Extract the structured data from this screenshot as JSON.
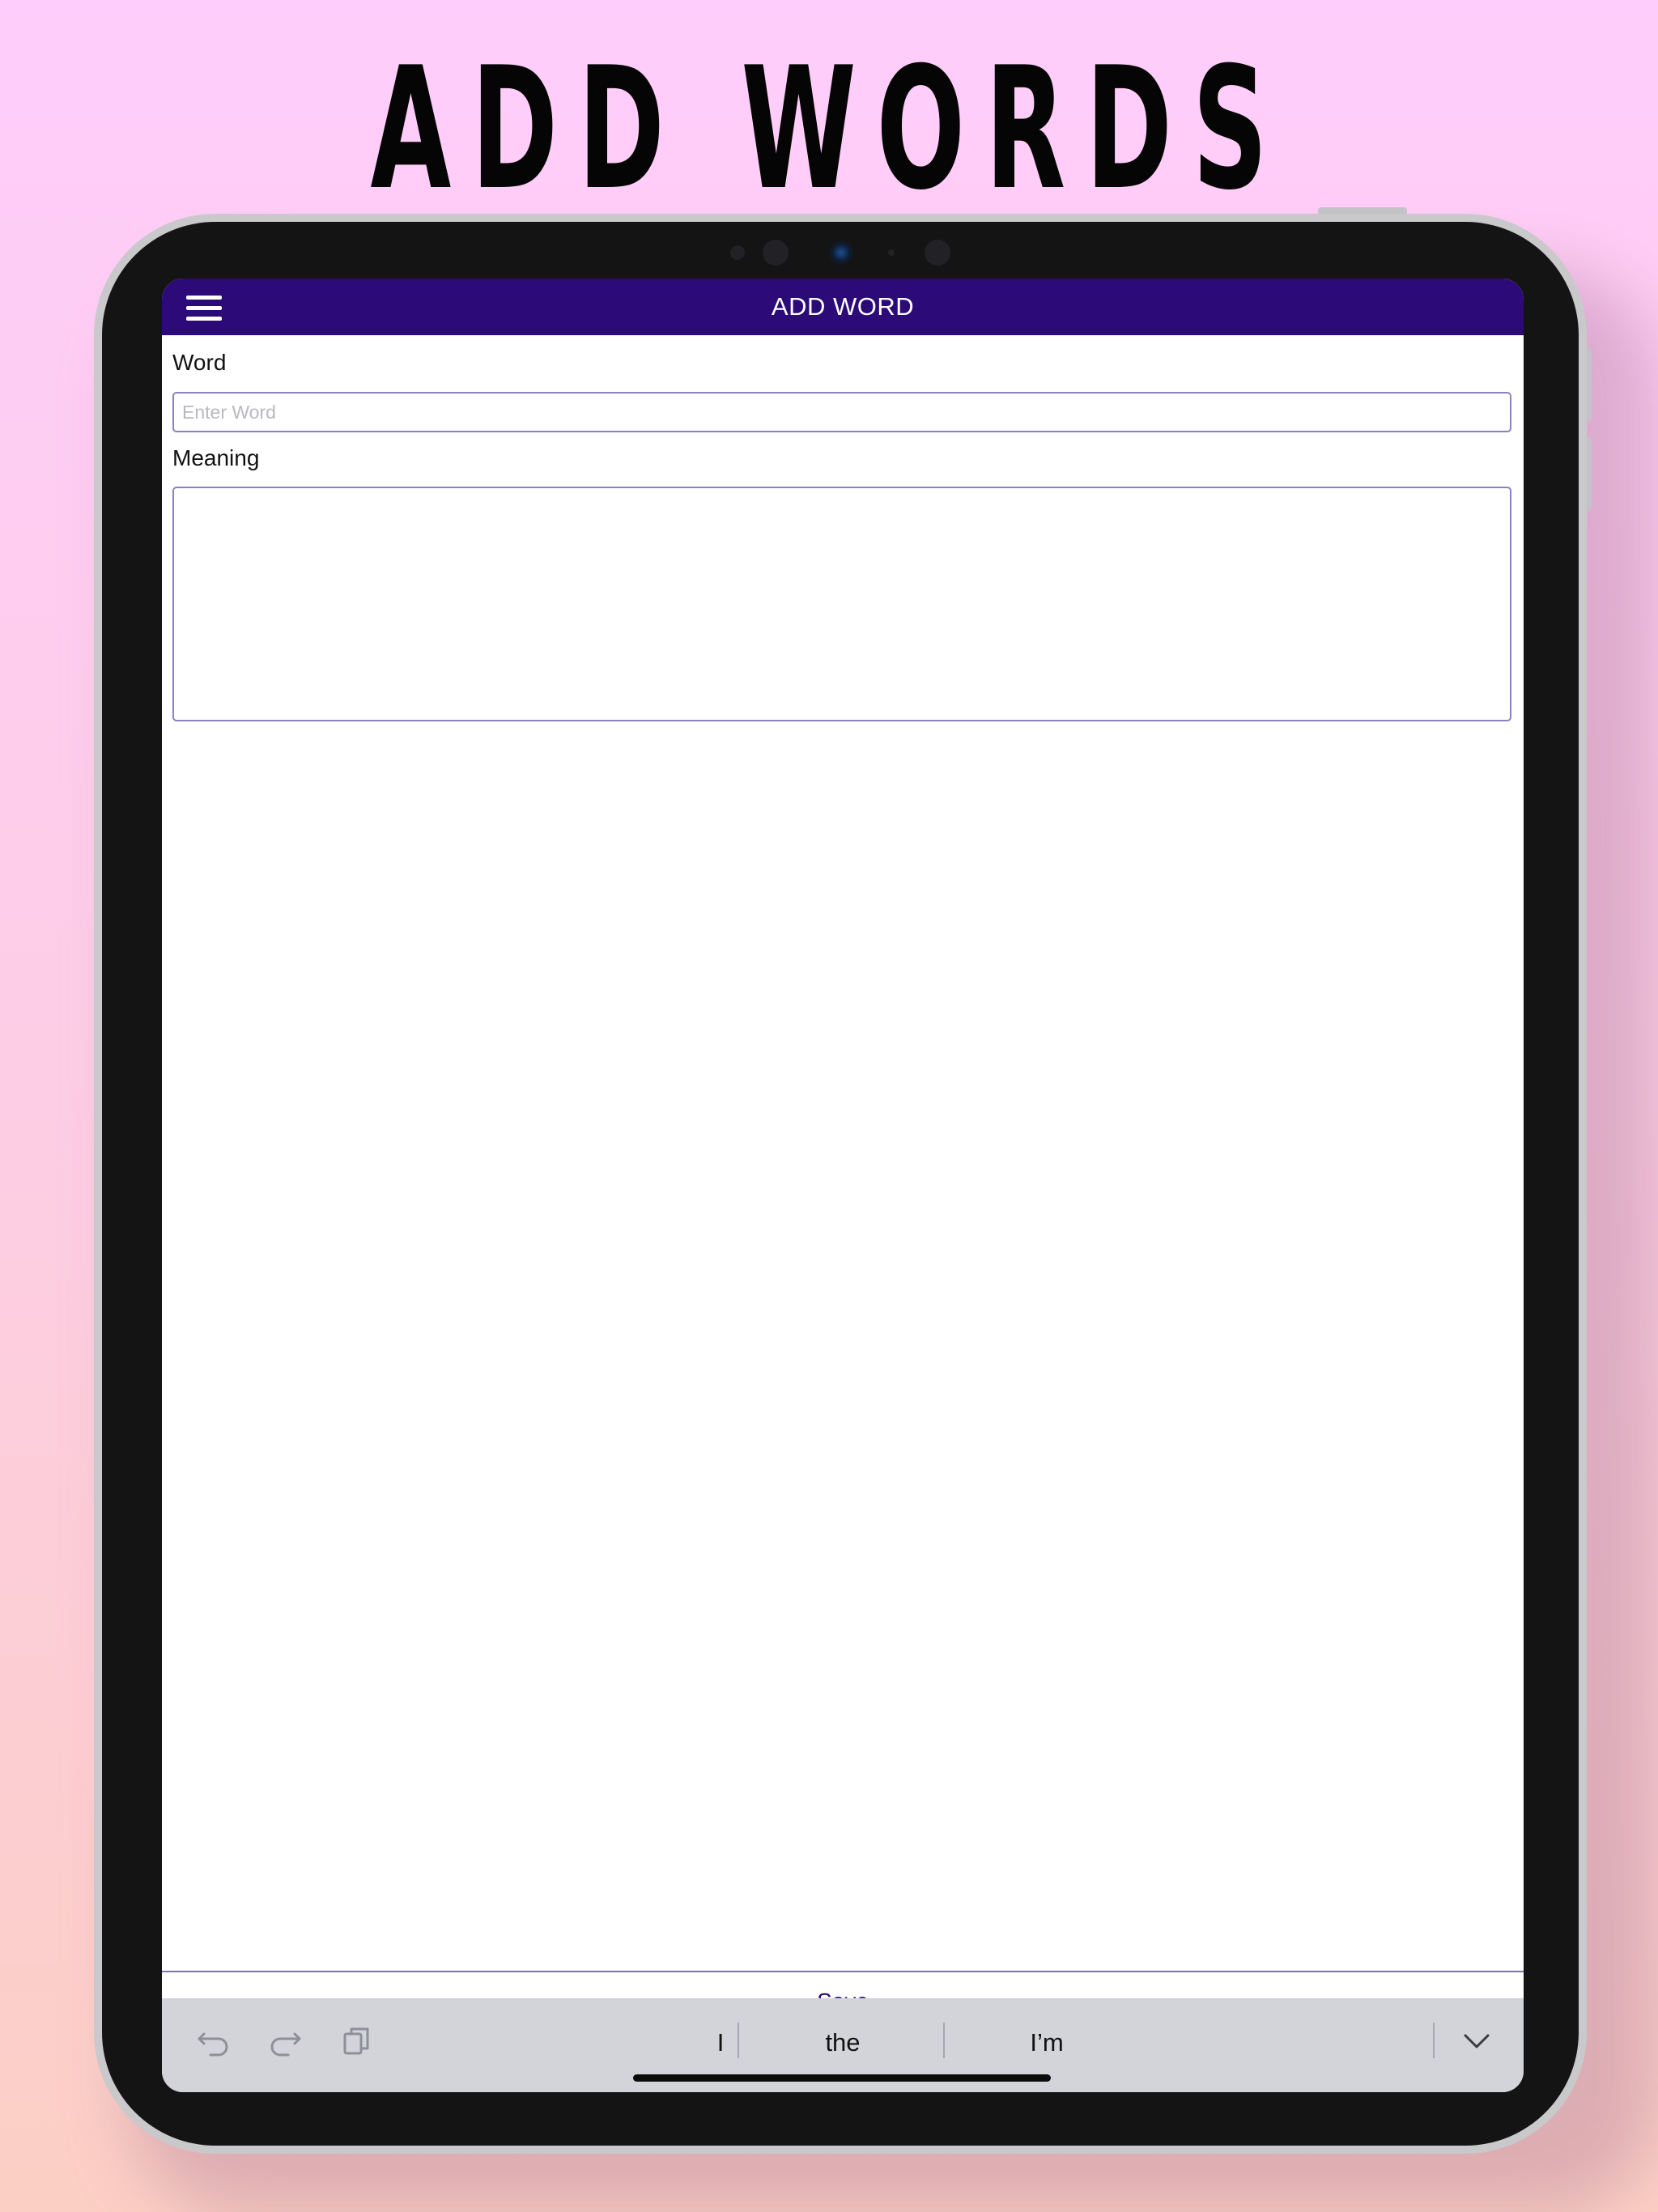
{
  "marketing": {
    "headline": "ADD WORDS"
  },
  "header": {
    "title": "ADD WORD",
    "menu_icon": "hamburger-menu-icon",
    "background_color": "#2c0a77"
  },
  "form": {
    "word_label": "Word",
    "word_placeholder": "Enter Word",
    "word_value": "",
    "meaning_label": "Meaning",
    "meaning_value": "",
    "border_color": "#8a80c4"
  },
  "save": {
    "label": "Save"
  },
  "keyboard": {
    "tools": [
      "undo-icon",
      "redo-icon",
      "paste-icon"
    ],
    "suggestions": [
      "I",
      "the",
      "I’m"
    ],
    "dismiss_icon": "chevron-down-icon"
  }
}
